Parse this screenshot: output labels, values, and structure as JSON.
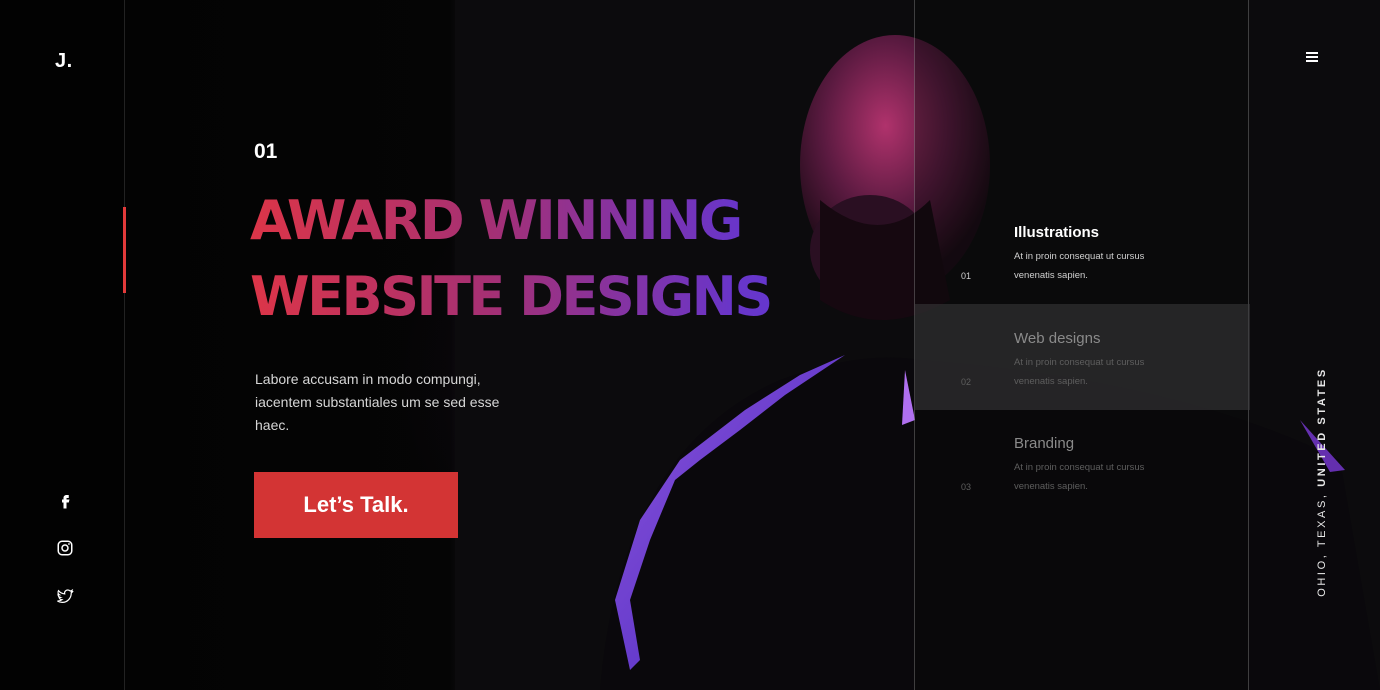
{
  "brand": {
    "logo": "J."
  },
  "hero": {
    "slide_number": "01",
    "headline_line1": "AWARD WINNING",
    "headline_line2": "WEBSITE DESIGNS",
    "intro": "Labore accusam in modo compungi, iacentem substantiales um se sed esse haec.",
    "cta_label": "Let’s Talk."
  },
  "social": [
    {
      "icon": "facebook-icon"
    },
    {
      "icon": "instagram-icon"
    },
    {
      "icon": "twitter-icon"
    }
  ],
  "services": [
    {
      "number": "01",
      "title": "Illustrations",
      "description": "At in proin consequat ut cursus venenatis sapien."
    },
    {
      "number": "02",
      "title": "Web designs",
      "description": "At in proin consequat ut cursus venenatis sapien."
    },
    {
      "number": "03",
      "title": "Branding",
      "description": "At in proin consequat ut cursus venenatis sapien."
    }
  ],
  "location": {
    "prefix": "OHIO, TEXAS, ",
    "country": "UNITED STATES"
  },
  "colors": {
    "accent": "#d33434",
    "gradient_start": "#dc3548",
    "gradient_end": "#5b3ad8"
  }
}
